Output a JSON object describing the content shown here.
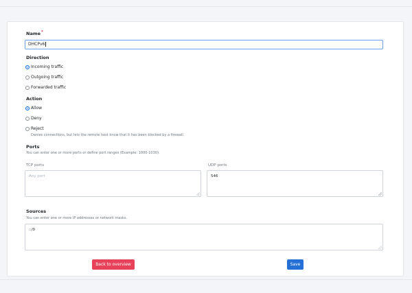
{
  "form": {
    "name": {
      "label": "Name",
      "required_mark": "*",
      "value": "DHCPv6"
    },
    "direction": {
      "label": "Direction",
      "options": [
        {
          "label": "Incoming traffic",
          "selected": true
        },
        {
          "label": "Outgoing traffic",
          "selected": false
        },
        {
          "label": "Forwarded traffic",
          "selected": false
        }
      ]
    },
    "action": {
      "label": "Action",
      "options": [
        {
          "label": "Allow",
          "selected": true
        },
        {
          "label": "Deny",
          "selected": false
        },
        {
          "label": "Reject",
          "selected": false
        }
      ],
      "reject_help": "Denies connections, but lets the remote host know that it has been blocked by a firewall."
    },
    "ports": {
      "label": "Ports",
      "help": "You can enter one or more ports or define port ranges (Example: 1000-1030).",
      "tcp": {
        "label": "TCP ports",
        "placeholder": "Any port",
        "value": ""
      },
      "udp": {
        "label": "UDP ports",
        "value": "546"
      }
    },
    "sources": {
      "label": "Sources",
      "help": "You can enter one or more IP addresses or network masks.",
      "value": "::/0"
    }
  },
  "buttons": {
    "back_label": "Back to overview",
    "save_label": "Save"
  },
  "colors": {
    "danger": "#e8415a",
    "primary": "#2470d6",
    "focus_border": "#6ea1ef",
    "required": "#dc3545"
  }
}
